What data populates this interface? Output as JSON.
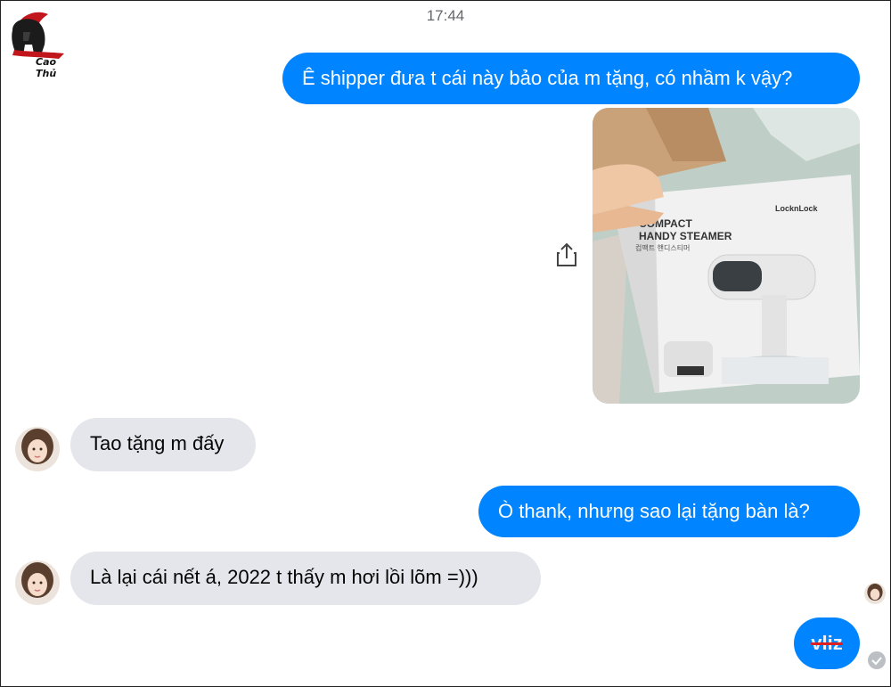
{
  "header": {
    "time": "17:44"
  },
  "logo": {
    "text": "Cao Thủ",
    "icon": "spartan-helmet-icon"
  },
  "messages": [
    {
      "from": "me",
      "text": "Ê shipper đưa t cái này bảo của m tặng, có nhầm k vậy?"
    },
    {
      "from": "me",
      "type": "image",
      "box_text": {
        "line1": "COMPACT",
        "line2": "HANDY STEAMER",
        "brand": "LocknLock",
        "korean": "컴팩트 핸디스티머"
      }
    },
    {
      "from": "them",
      "text": "Tao tặng m đấy"
    },
    {
      "from": "me",
      "text": "Ò thank, nhưng sao lại tặng bàn là?"
    },
    {
      "from": "them",
      "text": "Là lại cái nết á, 2022 t thấy m hơi lồi lõm =)))"
    },
    {
      "from": "me",
      "text": "vliz",
      "strikethrough": true
    }
  ],
  "colors": {
    "outgoing": "#0084ff",
    "incoming": "#e4e6eb",
    "strike": "#e02020"
  },
  "icons": {
    "share": "share-icon",
    "seen": "seen-avatar-icon",
    "delivered": "check-circle-icon"
  }
}
